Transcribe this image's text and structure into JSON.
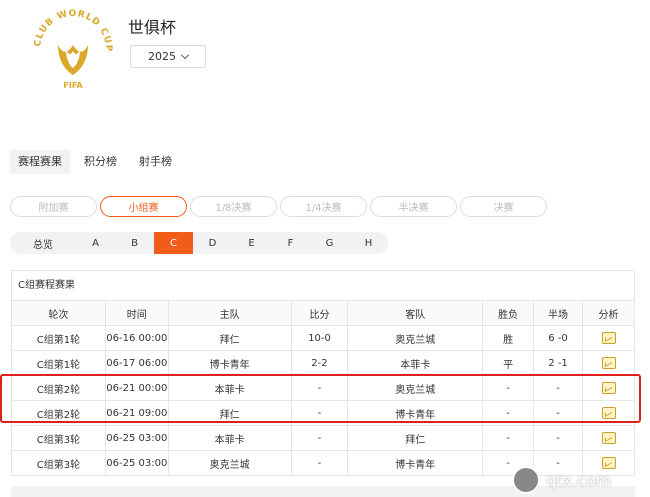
{
  "header": {
    "title": "世俱杯",
    "year": "2025",
    "logo_text": "CLUB WORLD CUP 25",
    "logo_sub": "FIFA"
  },
  "tabs": [
    {
      "label": "赛程赛果",
      "active": true
    },
    {
      "label": "积分榜",
      "active": false
    },
    {
      "label": "射手榜",
      "active": false
    }
  ],
  "stages": [
    {
      "label": "附加赛",
      "active": false
    },
    {
      "label": "小组赛",
      "active": true
    },
    {
      "label": "1/8决赛",
      "active": false
    },
    {
      "label": "1/4决赛",
      "active": false
    },
    {
      "label": "半决赛",
      "active": false
    },
    {
      "label": "决赛",
      "active": false
    }
  ],
  "groups": [
    {
      "label": "总览",
      "active": false
    },
    {
      "label": "A",
      "active": false
    },
    {
      "label": "B",
      "active": false
    },
    {
      "label": "C",
      "active": true
    },
    {
      "label": "D",
      "active": false
    },
    {
      "label": "E",
      "active": false
    },
    {
      "label": "F",
      "active": false
    },
    {
      "label": "G",
      "active": false
    },
    {
      "label": "H",
      "active": false
    }
  ],
  "table": {
    "caption": "C组赛程赛果",
    "columns": [
      "轮次",
      "时间",
      "主队",
      "比分",
      "客队",
      "胜负",
      "半场",
      "分析"
    ],
    "rows": [
      {
        "round": "C组第1轮",
        "time": "06-16 00:00",
        "home": "拜仁",
        "score": "10-0",
        "away": "奥克兰城",
        "result": "胜",
        "half": "6 -0"
      },
      {
        "round": "C组第1轮",
        "time": "06-17 06:00",
        "home": "博卡青年",
        "score": "2-2",
        "away": "本菲卡",
        "result": "平",
        "half": "2 -1"
      },
      {
        "round": "C组第2轮",
        "time": "06-21 00:00",
        "home": "本菲卡",
        "score": "-",
        "away": "奥克兰城",
        "result": "-",
        "half": "-"
      },
      {
        "round": "C组第2轮",
        "time": "06-21 09:00",
        "home": "拜仁",
        "score": "-",
        "away": "博卡青年",
        "result": "-",
        "half": "-"
      },
      {
        "round": "C组第3轮",
        "time": "06-25 03:00",
        "home": "本菲卡",
        "score": "-",
        "away": "拜仁",
        "result": "-",
        "half": "-"
      },
      {
        "round": "C组第3轮",
        "time": "06-25 03:00",
        "home": "奥克兰城",
        "score": "-",
        "away": "博卡青年",
        "result": "-",
        "half": "-"
      }
    ]
  },
  "watermark": "qtx.com",
  "colors": {
    "accent": "#f25c1b",
    "highlight": "#e0201c",
    "logo_gold": "#d9a82a"
  }
}
